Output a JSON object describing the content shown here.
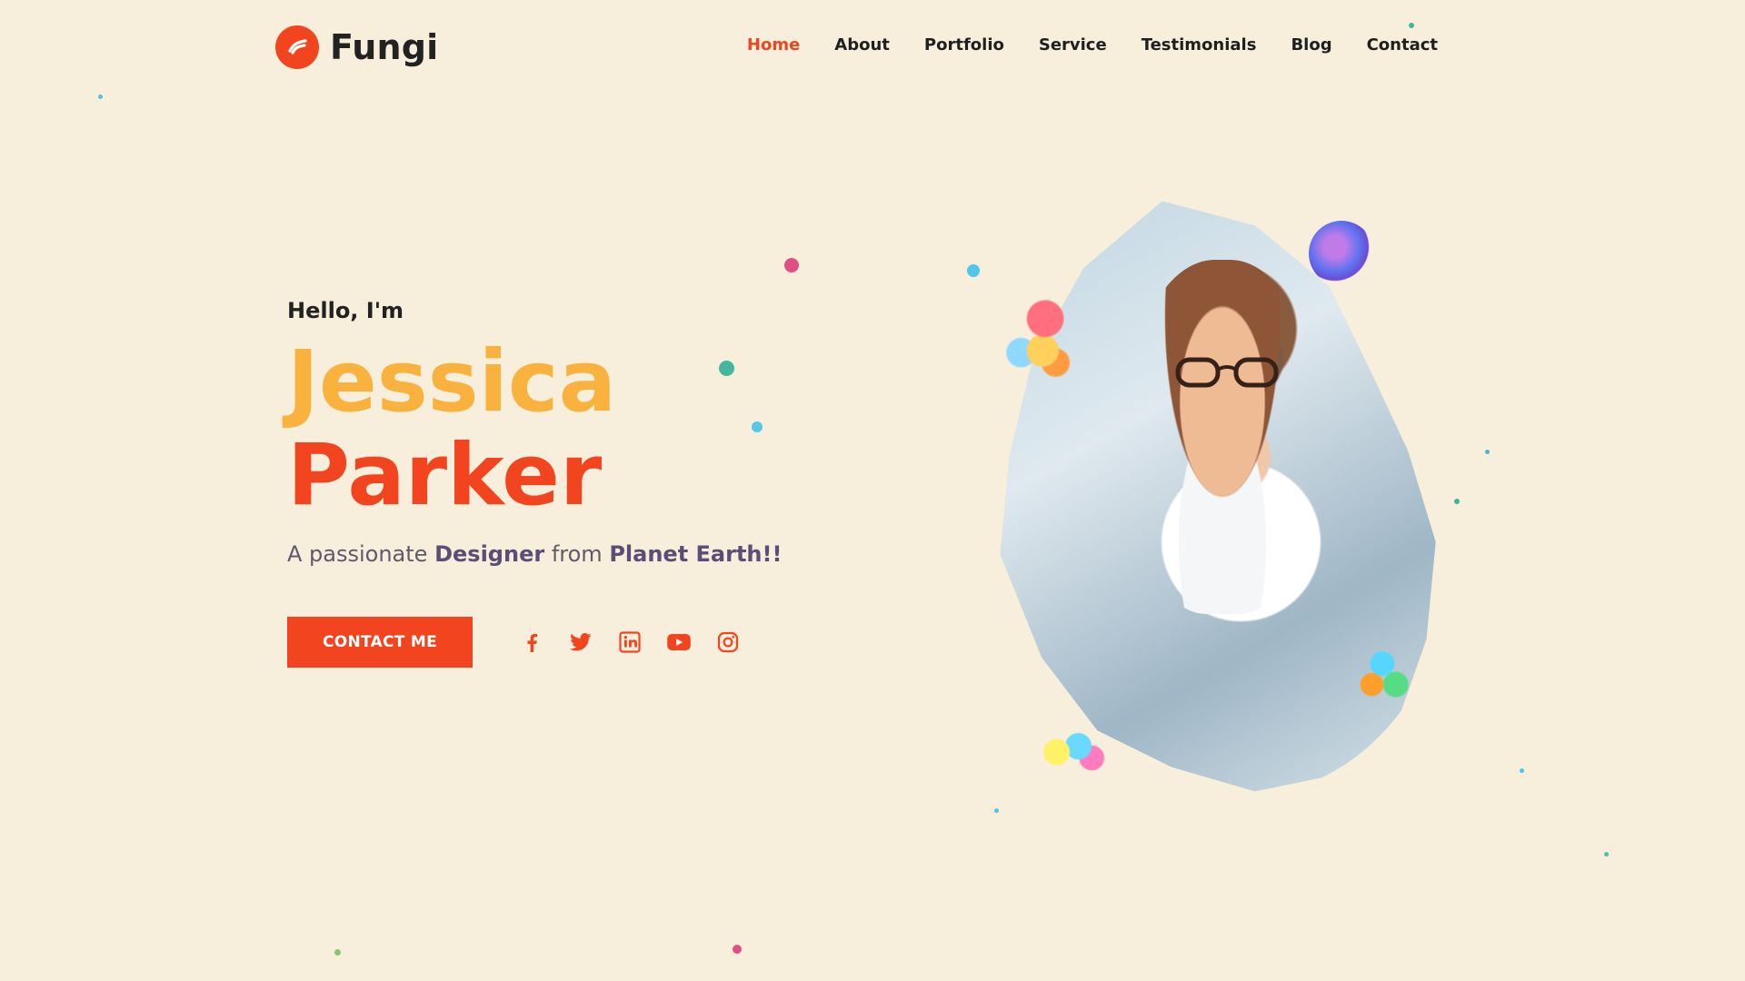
{
  "brand": {
    "name": "Fungi",
    "accent": "#f2441f",
    "yellow": "#f8b23d",
    "background": "#f7eedb",
    "text": "#1f1f1f",
    "muted": "#5f5a6b"
  },
  "nav": {
    "items": [
      {
        "label": "Home",
        "active": true
      },
      {
        "label": "About",
        "active": false
      },
      {
        "label": "Portfolio",
        "active": false
      },
      {
        "label": "Service",
        "active": false
      },
      {
        "label": "Testimonials",
        "active": false
      },
      {
        "label": "Blog",
        "active": false
      },
      {
        "label": "Contact",
        "active": false
      }
    ]
  },
  "hero": {
    "greeting": "Hello, I'm",
    "first_name": "Jessica",
    "last_name": "Parker",
    "tagline_prefix": "A passionate",
    "tagline_strong_1": "Designer",
    "tagline_mid": "from",
    "tagline_strong_2": "Planet Earth!!",
    "cta_label": "CONTACT ME"
  },
  "socials": [
    {
      "name": "facebook-icon"
    },
    {
      "name": "twitter-icon"
    },
    {
      "name": "linkedin-icon"
    },
    {
      "name": "youtube-icon"
    },
    {
      "name": "instagram-icon"
    }
  ]
}
